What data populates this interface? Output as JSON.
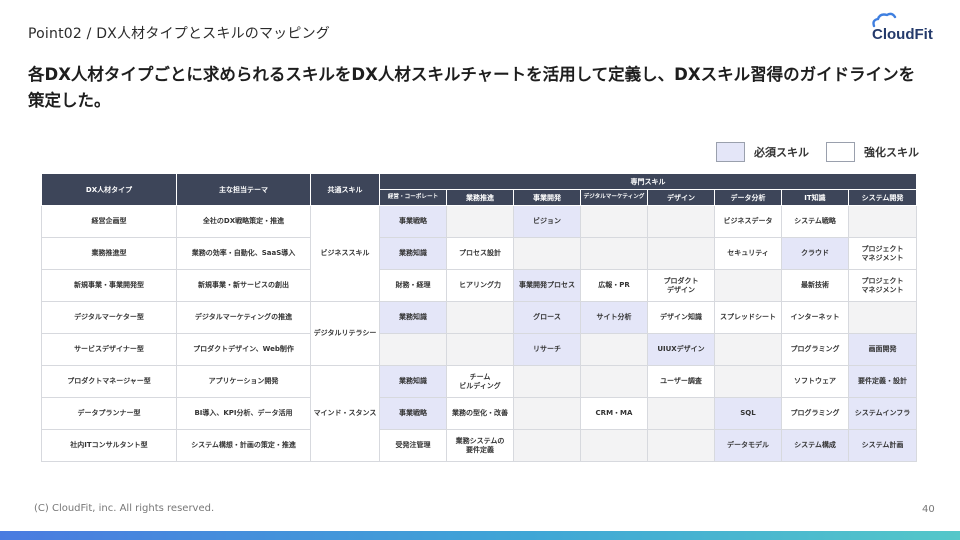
{
  "header": {
    "title": "Point02 / DX人材タイプとスキルのマッピング",
    "logo_text": "CloudFit"
  },
  "headline": "各DX人材タイプごとに求められるスキルをDX人材スキルチャートを活用して定義し、DXスキル習得のガイドラインを策定した。",
  "legend": {
    "required": "必須スキル",
    "enhanced": "強化スキル"
  },
  "table": {
    "headers": {
      "type": "DX人材タイプ",
      "theme": "主な担当テーマ",
      "common": "共通スキル",
      "specialized": "専門スキル"
    },
    "sub_headers": [
      "経営・コーポレート",
      "業務推進",
      "事業開発",
      "デジタルマーケティング",
      "デザイン",
      "データ分析",
      "IT知識",
      "システム開発"
    ],
    "common_skills": [
      "ビジネススキル",
      "デジタルリテラシー",
      "マインド・スタンス"
    ],
    "rows": [
      {
        "type": "経営企画型",
        "theme": "全社のDX戦略策定・推進",
        "cells": [
          {
            "t": "事業戦略",
            "k": "req"
          },
          {
            "t": "",
            "k": "empty"
          },
          {
            "t": "ビジョン",
            "k": "req"
          },
          {
            "t": "",
            "k": "empty"
          },
          {
            "t": "",
            "k": "empty"
          },
          {
            "t": "ビジネスデータ",
            "k": "enh"
          },
          {
            "t": "システム戦略",
            "k": "enh"
          },
          {
            "t": "",
            "k": "empty"
          }
        ]
      },
      {
        "type": "業務推進型",
        "theme": "業務の効率・自動化、SaaS導入",
        "cells": [
          {
            "t": "業務知識",
            "k": "req"
          },
          {
            "t": "プロセス設計",
            "k": "enh"
          },
          {
            "t": "",
            "k": "empty"
          },
          {
            "t": "",
            "k": "empty"
          },
          {
            "t": "",
            "k": "empty"
          },
          {
            "t": "セキュリティ",
            "k": "enh"
          },
          {
            "t": "クラウド",
            "k": "req"
          },
          {
            "t": "プロジェクト\nマネジメント",
            "k": "enh"
          }
        ]
      },
      {
        "type": "新規事業・事業開発型",
        "theme": "新規事業・新サービスの創出",
        "cells": [
          {
            "t": "財務・経理",
            "k": "enh"
          },
          {
            "t": "ヒアリング力",
            "k": "enh"
          },
          {
            "t": "事業開発プロセス",
            "k": "req"
          },
          {
            "t": "広報・PR",
            "k": "enh"
          },
          {
            "t": "プロダクト\nデザイン",
            "k": "enh"
          },
          {
            "t": "",
            "k": "empty"
          },
          {
            "t": "最新技術",
            "k": "enh"
          },
          {
            "t": "プロジェクト\nマネジメント",
            "k": "enh"
          }
        ]
      },
      {
        "type": "デジタルマーケター型",
        "theme": "デジタルマーケティングの推進",
        "cells": [
          {
            "t": "業務知識",
            "k": "req"
          },
          {
            "t": "",
            "k": "empty"
          },
          {
            "t": "グロース",
            "k": "req"
          },
          {
            "t": "サイト分析",
            "k": "req"
          },
          {
            "t": "デザイン知識",
            "k": "enh"
          },
          {
            "t": "スプレッドシート",
            "k": "enh"
          },
          {
            "t": "インターネット",
            "k": "enh"
          },
          {
            "t": "",
            "k": "empty"
          }
        ]
      },
      {
        "type": "サービスデザイナー型",
        "theme": "プロダクトデザイン、Web制作",
        "cells": [
          {
            "t": "",
            "k": "empty"
          },
          {
            "t": "",
            "k": "empty"
          },
          {
            "t": "リサーチ",
            "k": "req"
          },
          {
            "t": "",
            "k": "empty"
          },
          {
            "t": "UIUXデザイン",
            "k": "req"
          },
          {
            "t": "",
            "k": "empty"
          },
          {
            "t": "プログラミング",
            "k": "enh"
          },
          {
            "t": "画面開発",
            "k": "req"
          }
        ]
      },
      {
        "type": "プロダクトマネージャー型",
        "theme": "アプリケーション開発",
        "cells": [
          {
            "t": "業務知識",
            "k": "req"
          },
          {
            "t": "チーム\nビルディング",
            "k": "enh"
          },
          {
            "t": "",
            "k": "empty"
          },
          {
            "t": "",
            "k": "empty"
          },
          {
            "t": "ユーザー調査",
            "k": "enh"
          },
          {
            "t": "",
            "k": "empty"
          },
          {
            "t": "ソフトウェア",
            "k": "enh"
          },
          {
            "t": "要件定義・設計",
            "k": "req"
          }
        ]
      },
      {
        "type": "データプランナー型",
        "theme": "BI導入、KPI分析、データ活用",
        "cells": [
          {
            "t": "事業戦略",
            "k": "req"
          },
          {
            "t": "業務の型化・改善",
            "k": "enh"
          },
          {
            "t": "",
            "k": "empty"
          },
          {
            "t": "CRM・MA",
            "k": "enh"
          },
          {
            "t": "",
            "k": "empty"
          },
          {
            "t": "SQL",
            "k": "req"
          },
          {
            "t": "プログラミング",
            "k": "enh"
          },
          {
            "t": "システムインフラ",
            "k": "req"
          }
        ]
      },
      {
        "type": "社内ITコンサルタント型",
        "theme": "システム構想・計画の策定・推進",
        "cells": [
          {
            "t": "受発注管理",
            "k": "enh"
          },
          {
            "t": "業務システムの\n要件定義",
            "k": "enh"
          },
          {
            "t": "",
            "k": "empty"
          },
          {
            "t": "",
            "k": "empty"
          },
          {
            "t": "",
            "k": "empty"
          },
          {
            "t": "データモデル",
            "k": "req"
          },
          {
            "t": "システム構成",
            "k": "req"
          },
          {
            "t": "システム計画",
            "k": "req"
          }
        ]
      }
    ]
  },
  "footer": {
    "copyright": "(C) CloudFit, inc. All rights reserved.",
    "page_number": "40"
  },
  "colors": {
    "header_bg": "#3d4559",
    "required_fill": "#e4e6f8",
    "enhanced_fill": "#ffffff",
    "brand": "#243a6b"
  }
}
